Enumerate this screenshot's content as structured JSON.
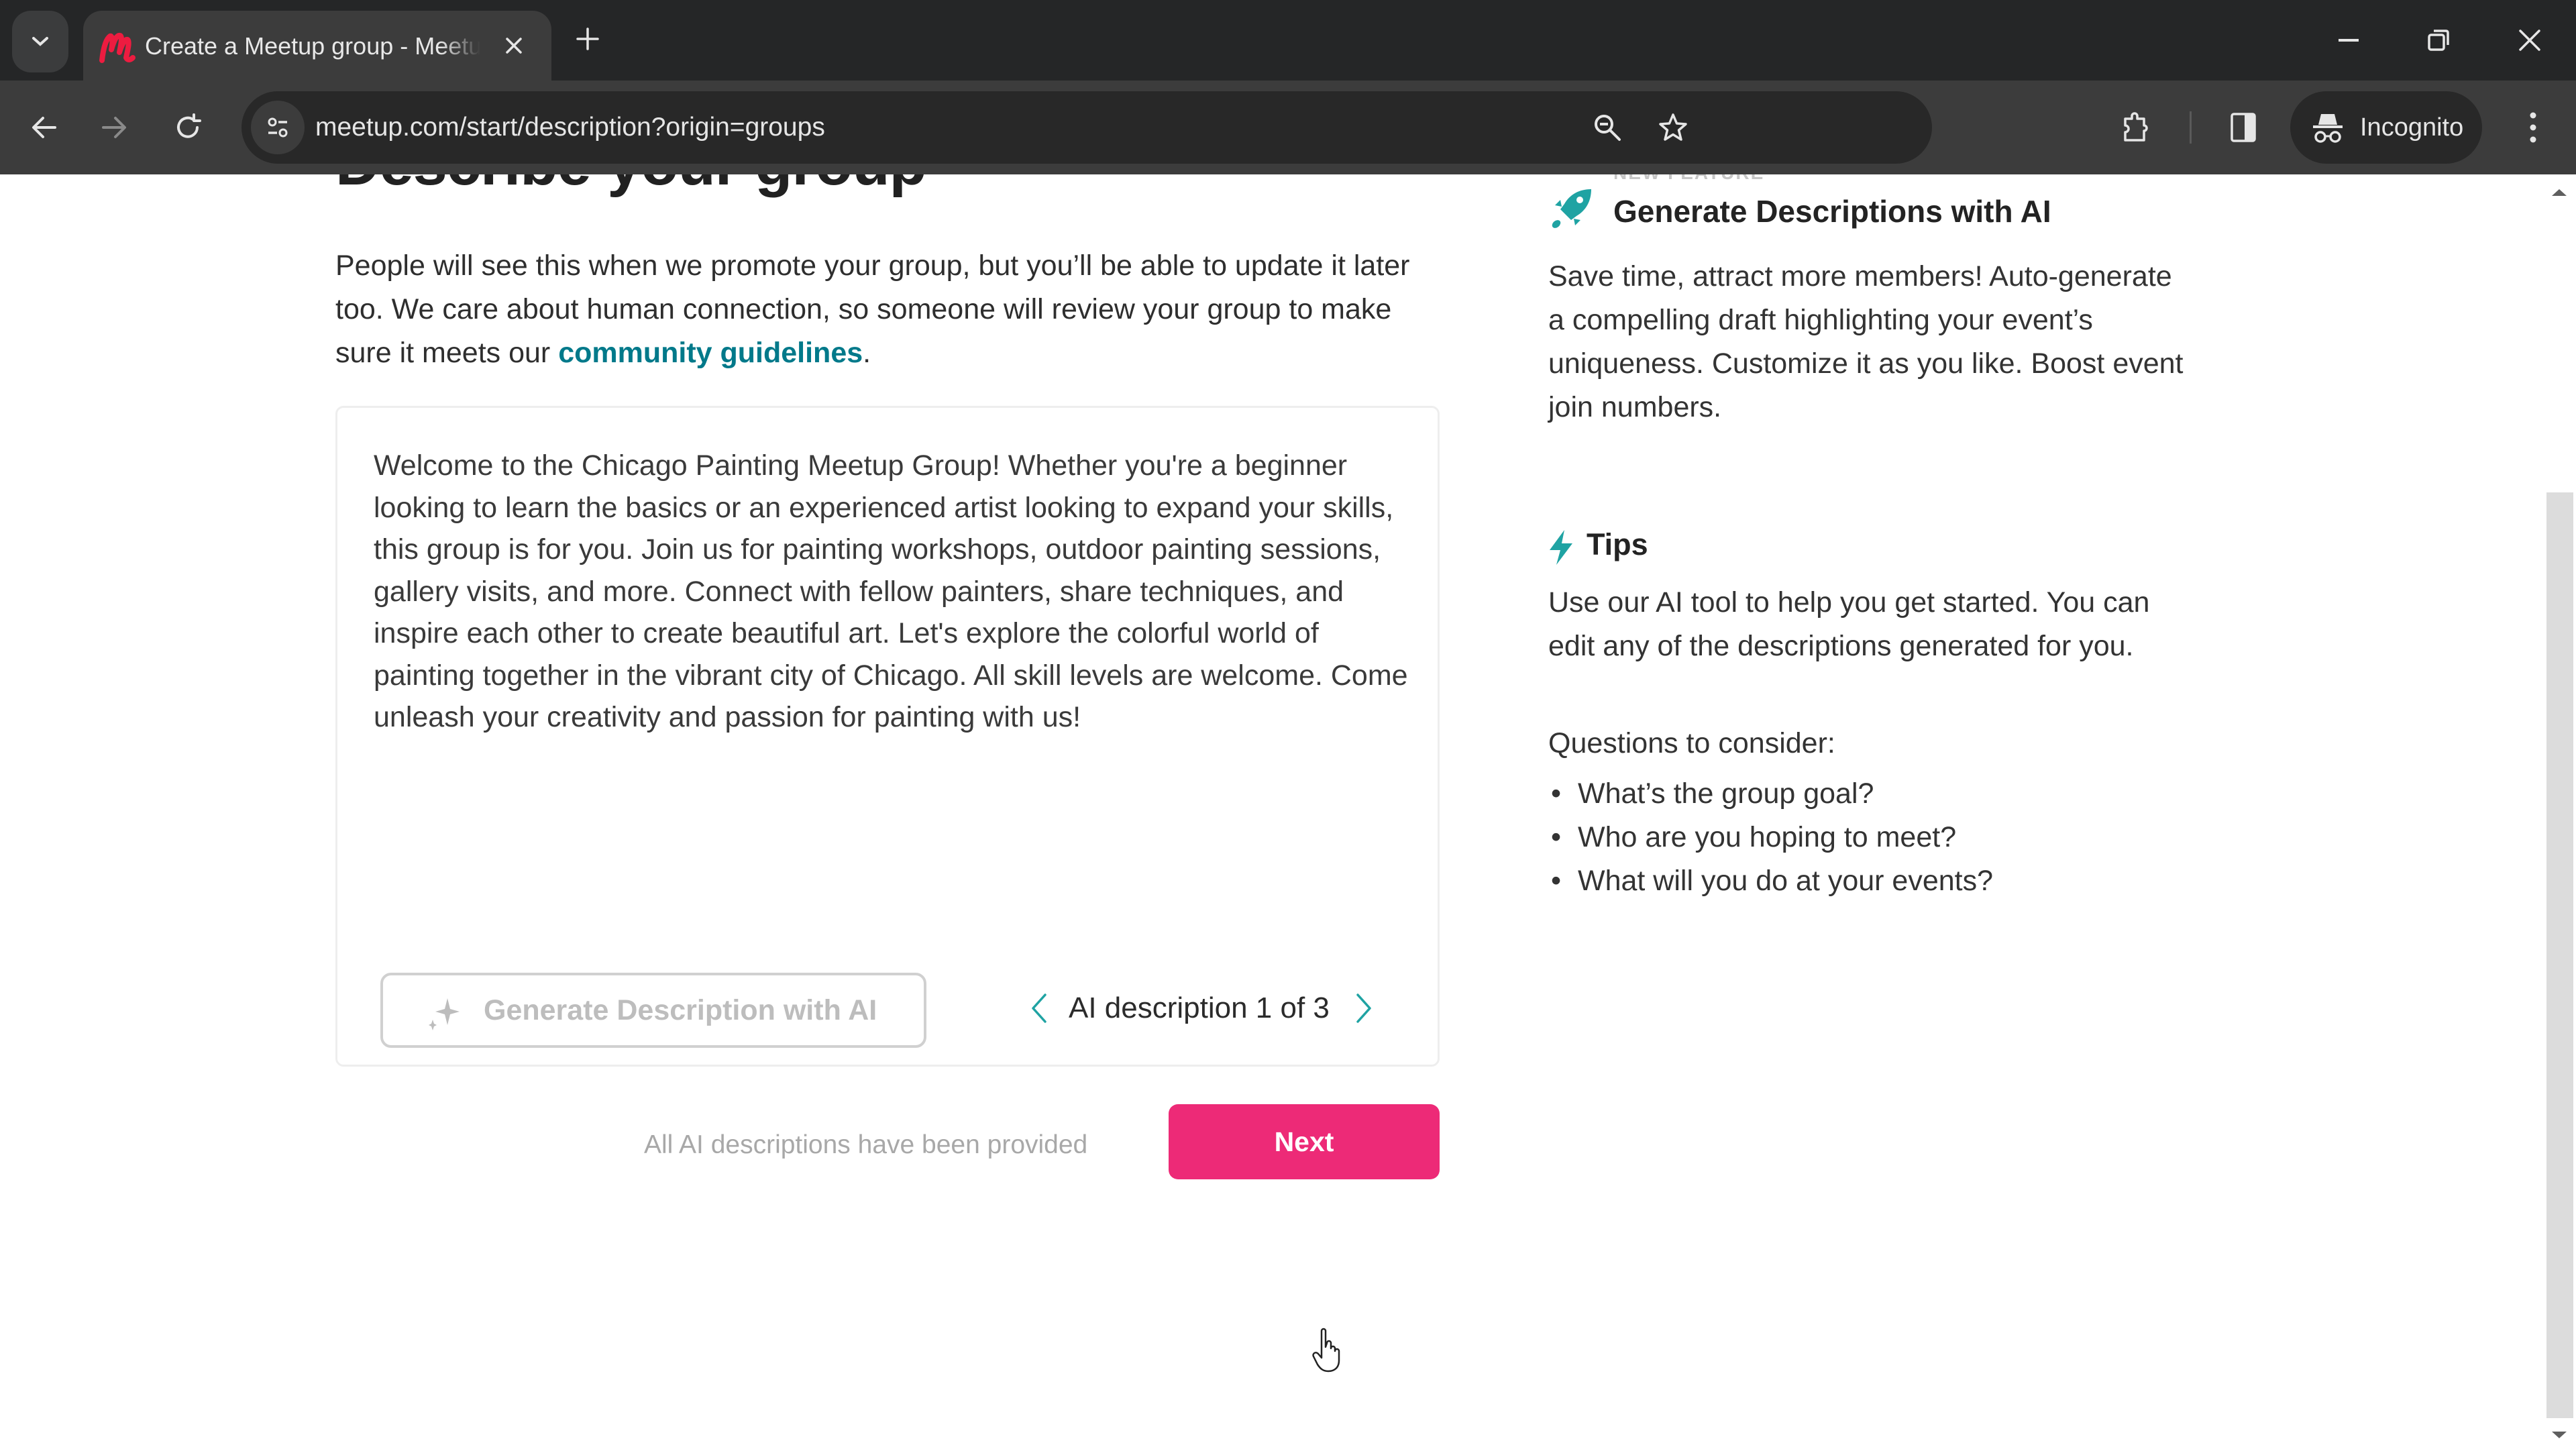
{
  "browser": {
    "tab_title": "Create a Meetup group - Meetup",
    "url": "meetup.com/start/description?origin=groups",
    "incognito_label": "Incognito",
    "favicon_color": "#ED1C40"
  },
  "page": {
    "heading": "Describe your group",
    "intro_text": "People will see this when we promote your group, but you’ll be able to update it later too. We care about human connection, so someone will review your group to make sure it meets our ",
    "intro_link": "community guidelines",
    "intro_suffix": ".",
    "description_value": "Welcome to the Chicago Painting Meetup Group! Whether you're a beginner looking to learn the basics or an experienced artist looking to expand your skills, this group is for you. Join us for painting workshops, outdoor painting sessions, gallery visits, and more. Connect with fellow painters, share techniques, and inspire each other to create beautiful art. Let's explore the colorful world of painting together in the vibrant city of Chicago. All skill levels are welcome. Come unleash your creativity and passion for painting with us!",
    "generate_button_label": "Generate Description with AI",
    "pager_label": "AI description 1 of 3",
    "pager_current": 1,
    "pager_total": 3,
    "status_note": "All AI descriptions have been provided",
    "next_button_label": "Next"
  },
  "sidebar": {
    "badge": "NEW FEATURE",
    "feature_title": "Generate Descriptions with AI",
    "feature_desc": "Save time, attract more members! Auto-generate a compelling draft highlighting your event’s uniqueness. Customize it as you like. Boost event join numbers.",
    "tips_title": "Tips",
    "tips_desc": "Use our AI tool to help you get started. You can edit any of the descriptions generated for you.",
    "questions_label": "Questions to consider:",
    "questions": [
      "What’s the group goal?",
      "Who are you hoping to meet?",
      "What will you do at your events?"
    ]
  },
  "colors": {
    "accent_pink": "#ED2A77",
    "teal": "#00798A",
    "icon_teal": "#1FA3A3"
  }
}
